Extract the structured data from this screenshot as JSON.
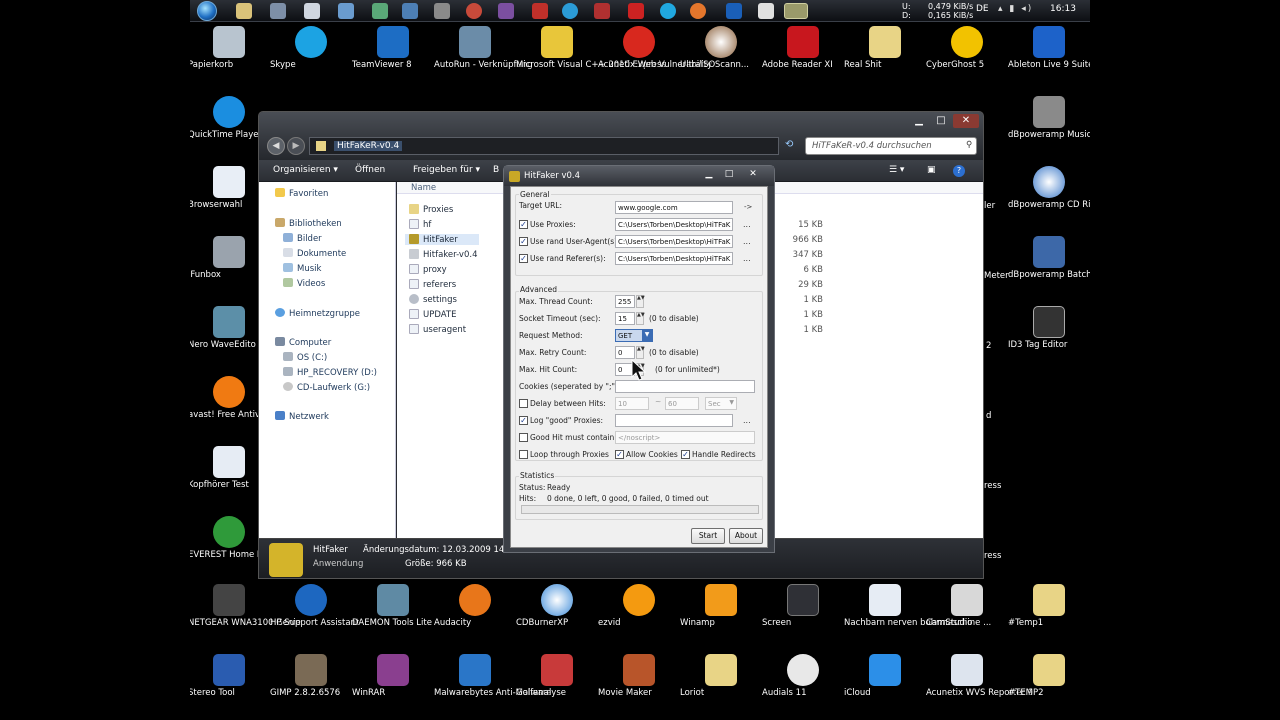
{
  "taskbar": {
    "net_label_up": "U:",
    "net_label_down": "D:",
    "speed_up": "0,479 KiB/s",
    "speed_down": "0,165 KiB/s",
    "language": "DE",
    "clock": "16:13"
  },
  "desktop_icons": {
    "papierkorb": "Papierkorb",
    "skype": "Skype",
    "teamviewer": "TeamViewer 8",
    "autorun": "AutoRun - Verknüpfung",
    "msvc": "Microsoft Visual C++ 2010 Express",
    "acunetix_web": "Acunetix Web Vulnerability Scann...",
    "ultraiso": "UltraISO",
    "adobe": "Adobe Reader XI",
    "realshit": "Real Shit",
    "cyberghost": "CyberGhost 5",
    "ableton": "Ableton Live 9 Suite",
    "quicktime": "QuickTime Playe",
    "dbpoweramp_conv": "dBpoweramp Music Converter",
    "browserwahl": "Browserwahl",
    "dbpoweramp_cd": "dBpoweramp CD Ripper",
    "ifunbox": "iFunbox",
    "dbpoweramp_batch": "dBpoweramp Batch Converter",
    "meter": "Meter",
    "nero": "Nero WaveEdito",
    "id3": "ID3 Tag Editor",
    "two": "2",
    "avast": "avast! Free Antivir",
    "d": "d",
    "kopfhoerer": "Kopfhörer Test",
    "ress1": "ress",
    "everest": "EVEREST Home Edition",
    "ress2": "ress",
    "ler": "ler",
    "netgear": "NETGEAR WNA3100 Genie",
    "hpsupport": "HP Support Assistant",
    "daemon": "DAEMON Tools Lite",
    "audacity": "Audacity",
    "cdburner": "CDBurnerXP",
    "ezvid": "ezvid",
    "winamp": "Winamp",
    "screen": "Screen",
    "nachbarn": "Nachbarn nerven bohrmaschine ...",
    "camstudio": "CamStudio",
    "temp1": "#Temp1",
    "stereo": "Stereo Tool",
    "gimp": "GIMP 2.8.2.6576",
    "winrar": "WinRAR",
    "malwarebytes": "Malwarebytes Anti-Malware",
    "golfanalyse": "Golfanalyse",
    "moviemaker": "Movie Maker",
    "loriot": "Loriot",
    "audials": "Audials 11",
    "icloud": "iCloud",
    "acunetix_wvs": "Acunetix WVS Reporter 9",
    "temp2": "#TEMP2"
  },
  "explorer": {
    "breadcrumb": "HitFaKeR-v0.4",
    "search_placeholder": "HiTFaKeR-v0.4 durchsuchen",
    "toolbar": [
      "Organisieren ▾",
      "Öffnen",
      "Freigeben für ▾",
      "B"
    ],
    "sidebar": {
      "favoriten": "Favoriten",
      "bibliotheken": "Bibliotheken",
      "bilder": "Bilder",
      "dokumente": "Dokumente",
      "musik": "Musik",
      "videos": "Videos",
      "heimnetz": "Heimnetzgruppe",
      "computer": "Computer",
      "os": "OS (C:)",
      "hp_recovery": "HP_RECOVERY (D:)",
      "cd": "CD-Laufwerk (G:)",
      "netzwerk": "Netzwerk"
    },
    "column_name": "Name",
    "files": [
      {
        "name": "Proxies",
        "size": ""
      },
      {
        "name": "hf",
        "size": "15 KB"
      },
      {
        "name": "HitFaker",
        "size": "966 KB"
      },
      {
        "name": "Hitfaker-v0.4",
        "size": "347 KB"
      },
      {
        "name": "proxy",
        "size": "6 KB"
      },
      {
        "name": "referers",
        "size": "29 KB"
      },
      {
        "name": "settings",
        "size": "1 KB"
      },
      {
        "name": "UPDATE",
        "size": "1 KB"
      },
      {
        "name": "useragent",
        "size": "1 KB"
      }
    ],
    "details": {
      "name": "HitFaker",
      "type": "Anwendung",
      "modified_label": "Änderungsdatum: 12.03.2009 14:56",
      "size_label": "Größe: 966 KB"
    }
  },
  "hitfaker": {
    "title": "HitFaker v0.4",
    "general_label": "General",
    "target_url_label": "Target URL:",
    "target_url_value": "www.google.com",
    "go_arrow": "->",
    "use_proxies_label": "Use Proxies:",
    "use_proxies_path": "C:\\Users\\Torben\\Desktop\\HiTFaK",
    "rand_useragent_label": "Use rand User-Agent(s):",
    "rand_useragent_path": "C:\\Users\\Torben\\Desktop\\HiTFaK",
    "rand_referer_label": "Use rand Referer(s):",
    "rand_referer_path": "C:\\Users\\Torben\\Desktop\\HiTFaK",
    "browse": "...",
    "advanced_label": "Advanced",
    "thread_count_label": "Max. Thread Count:",
    "thread_count_value": "255",
    "socket_timeout_label": "Socket Timeout (sec):",
    "socket_timeout_value": "15",
    "socket_timeout_hint": "(0 to disable)",
    "request_method_label": "Request Method:",
    "request_method_value": "GET",
    "retry_count_label": "Max. Retry Count:",
    "retry_count_value": "0",
    "retry_count_hint": "(0 to disable)",
    "hit_count_label": "Max. Hit Count:",
    "hit_count_value": "0",
    "hit_count_hint": "(0 for unlimited*)",
    "cookies_label": "Cookies (seperated by \";\"):",
    "delay_label": "Delay between Hits:",
    "delay_from": "10",
    "delay_tilde": "~",
    "delay_to": "60",
    "delay_unit": "Sec",
    "log_good_label": "Log \"good\" Proxies:",
    "good_hit_label": "Good Hit must contain:",
    "good_hit_value": "</noscript>",
    "loop_label": "Loop through Proxies",
    "allow_cookies_label": "Allow Cookies",
    "handle_redirects_label": "Handle Redirects",
    "statistics_label": "Statistics",
    "status_label": "Status:",
    "status_value": "Ready",
    "hits_label": "Hits:",
    "hits_value": "0 done, 0 left, 0 good, 0 failed, 0 timed out",
    "start_button": "Start",
    "about_button": "About"
  },
  "colors": {
    "accent": "#1f6fc4",
    "window_dark": "#2a2d33"
  }
}
